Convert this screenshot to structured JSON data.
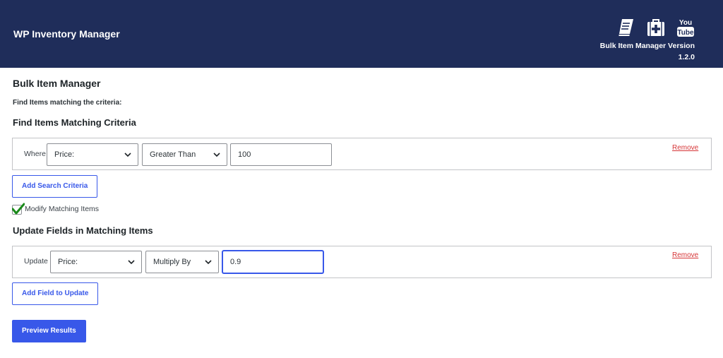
{
  "header": {
    "app_title": "WP Inventory Manager",
    "version_line1": "Bulk Item Manager Version",
    "version_line2": "1.2.0",
    "icons": [
      "manual-book-icon",
      "support-first-aid-icon",
      "youtube-icon"
    ],
    "youtube_text_top": "You",
    "youtube_text_bottom": "Tube",
    "background_color": "#1f2d5a"
  },
  "page": {
    "title": "Bulk Item Manager",
    "subtext": "Find Items matching the criteria:"
  },
  "find": {
    "heading": "Find Items Matching Criteria",
    "row": {
      "label": "Where",
      "field": "Price:",
      "operator": "Greater Than",
      "value": "100",
      "remove_label": "Remove"
    },
    "add_button": "Add Search Criteria"
  },
  "modify": {
    "checked": true,
    "label": "Modify Matching Items"
  },
  "update": {
    "heading": "Update Fields in Matching Items",
    "row": {
      "label": "Update",
      "field": "Price:",
      "operation": "Multiply By",
      "value": "0.9",
      "remove_label": "Remove"
    },
    "add_button": "Add Field to Update"
  },
  "actions": {
    "preview_button": "Preview Results"
  },
  "colors": {
    "accent": "#3858e9",
    "danger": "#d63638",
    "check": "#1a8a1a"
  }
}
